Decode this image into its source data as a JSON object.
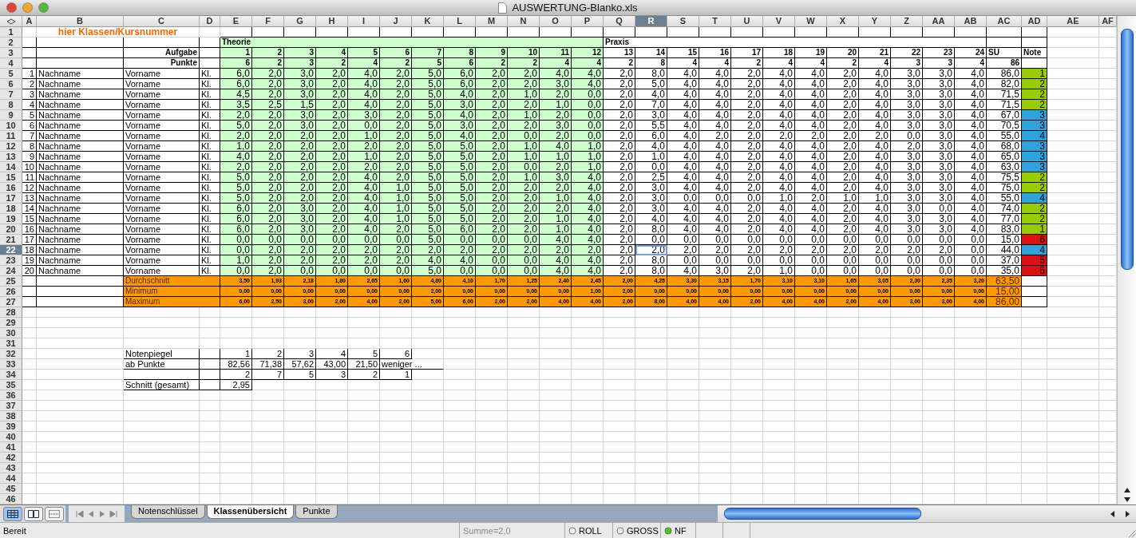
{
  "window": {
    "title": "AUSWERTUNG-Blanko.xls"
  },
  "column_headers": [
    {
      "label": "A",
      "selected": false
    },
    {
      "label": "B",
      "selected": false
    },
    {
      "label": "C",
      "selected": false
    },
    {
      "label": "D",
      "selected": false
    },
    {
      "label": "E",
      "selected": false
    },
    {
      "label": "F",
      "selected": false
    },
    {
      "label": "G",
      "selected": false
    },
    {
      "label": "H",
      "selected": false
    },
    {
      "label": "I",
      "selected": false
    },
    {
      "label": "J",
      "selected": false
    },
    {
      "label": "K",
      "selected": false
    },
    {
      "label": "L",
      "selected": false
    },
    {
      "label": "M",
      "selected": false
    },
    {
      "label": "N",
      "selected": false
    },
    {
      "label": "O",
      "selected": false
    },
    {
      "label": "P",
      "selected": false
    },
    {
      "label": "Q",
      "selected": false
    },
    {
      "label": "R",
      "selected": true
    },
    {
      "label": "S",
      "selected": false
    },
    {
      "label": "T",
      "selected": false
    },
    {
      "label": "U",
      "selected": false
    },
    {
      "label": "V",
      "selected": false
    },
    {
      "label": "W",
      "selected": false
    },
    {
      "label": "X",
      "selected": false
    },
    {
      "label": "Y",
      "selected": false
    },
    {
      "label": "Z",
      "selected": false
    },
    {
      "label": "AA",
      "selected": false
    },
    {
      "label": "AB",
      "selected": false
    },
    {
      "label": "AC",
      "selected": false
    },
    {
      "label": "AD",
      "selected": false
    },
    {
      "label": "AE",
      "selected": false
    },
    {
      "label": "AF",
      "selected": false
    }
  ],
  "row_headers": [
    {
      "label": "1",
      "selected": false
    },
    {
      "label": "2",
      "selected": false
    },
    {
      "label": "3",
      "selected": false
    },
    {
      "label": "4",
      "selected": false
    },
    {
      "label": "5",
      "selected": false
    },
    {
      "label": "6",
      "selected": false
    },
    {
      "label": "7",
      "selected": false
    },
    {
      "label": "8",
      "selected": false
    },
    {
      "label": "9",
      "selected": false
    },
    {
      "label": "10",
      "selected": false
    },
    {
      "label": "11",
      "selected": false
    },
    {
      "label": "12",
      "selected": false
    },
    {
      "label": "13",
      "selected": false
    },
    {
      "label": "14",
      "selected": false
    },
    {
      "label": "15",
      "selected": false
    },
    {
      "label": "16",
      "selected": false
    },
    {
      "label": "17",
      "selected": false
    },
    {
      "label": "18",
      "selected": false
    },
    {
      "label": "19",
      "selected": false
    },
    {
      "label": "20",
      "selected": false
    },
    {
      "label": "21",
      "selected": false
    },
    {
      "label": "22",
      "selected": true
    },
    {
      "label": "23",
      "selected": false
    },
    {
      "label": "24",
      "selected": false
    },
    {
      "label": "25",
      "selected": false
    },
    {
      "label": "26",
      "selected": false
    },
    {
      "label": "27",
      "selected": false
    },
    {
      "label": "28",
      "selected": false
    },
    {
      "label": "29",
      "selected": false
    },
    {
      "label": "30",
      "selected": false
    },
    {
      "label": "31",
      "selected": false
    },
    {
      "label": "32",
      "selected": false
    },
    {
      "label": "33",
      "selected": false
    },
    {
      "label": "34",
      "selected": false
    },
    {
      "label": "35",
      "selected": false
    },
    {
      "label": "36",
      "selected": false
    },
    {
      "label": "37",
      "selected": false
    },
    {
      "label": "38",
      "selected": false
    },
    {
      "label": "39",
      "selected": false
    },
    {
      "label": "40",
      "selected": false
    },
    {
      "label": "41",
      "selected": false
    },
    {
      "label": "42",
      "selected": false
    },
    {
      "label": "43",
      "selected": false
    },
    {
      "label": "44",
      "selected": false
    },
    {
      "label": "45",
      "selected": false
    },
    {
      "label": "46",
      "selected": false
    }
  ],
  "title_cell": "hier Klassen/Kursnummer",
  "sections": [
    {
      "label": "Theorie",
      "kind": "theory"
    },
    {
      "label": "Praxis",
      "kind": "practice"
    }
  ],
  "task_header": {
    "label": "Aufgabe",
    "numbers": [
      "1",
      "2",
      "3",
      "4",
      "5",
      "6",
      "7",
      "8",
      "9",
      "10",
      "11",
      "12",
      "13",
      "14",
      "15",
      "16",
      "17",
      "18",
      "19",
      "20",
      "21",
      "22",
      "23",
      "24"
    ],
    "sum_label": "SU",
    "grade_label": "Note"
  },
  "points_header": {
    "label": "Punkte",
    "max_points": [
      "6",
      "2",
      "3",
      "2",
      "4",
      "2",
      "5",
      "6",
      "2",
      "2",
      "4",
      "4",
      "2",
      "8",
      "4",
      "4",
      "2",
      "4",
      "4",
      "2",
      "4",
      "3",
      "3",
      "4"
    ],
    "total": "86"
  },
  "students": [
    {
      "no": "1",
      "last_name": "Nachname",
      "first_name": "Vorname",
      "class": "Kl.",
      "points": [
        "6,0",
        "2,0",
        "3,0",
        "2,0",
        "4,0",
        "2,0",
        "5,0",
        "6,0",
        "2,0",
        "2,0",
        "4,0",
        "4,0",
        "2,0",
        "8,0",
        "4,0",
        "4,0",
        "2,0",
        "4,0",
        "4,0",
        "2,0",
        "4,0",
        "3,0",
        "3,0",
        "4,0"
      ],
      "sum": "86,0",
      "grade": "1",
      "color": "#99cc00"
    },
    {
      "no": "2",
      "last_name": "Nachname",
      "first_name": "Vorname",
      "class": "Kl.",
      "points": [
        "6,0",
        "2,0",
        "3,0",
        "2,0",
        "4,0",
        "2,0",
        "5,0",
        "6,0",
        "2,0",
        "2,0",
        "3,0",
        "4,0",
        "2,0",
        "5,0",
        "4,0",
        "4,0",
        "2,0",
        "4,0",
        "4,0",
        "2,0",
        "4,0",
        "3,0",
        "3,0",
        "4,0"
      ],
      "sum": "82,0",
      "grade": "2",
      "color": "#99cc00"
    },
    {
      "no": "3",
      "last_name": "Nachname",
      "first_name": "Vorname",
      "class": "Kl.",
      "points": [
        "4,5",
        "2,0",
        "3,0",
        "2,0",
        "4,0",
        "2,0",
        "5,0",
        "4,0",
        "2,0",
        "1,0",
        "2,0",
        "0,0",
        "2,0",
        "4,0",
        "4,0",
        "4,0",
        "2,0",
        "4,0",
        "4,0",
        "2,0",
        "4,0",
        "3,0",
        "3,0",
        "4,0"
      ],
      "sum": "71,5",
      "grade": "2",
      "color": "#99cc00"
    },
    {
      "no": "4",
      "last_name": "Nachname",
      "first_name": "Vorname",
      "class": "Kl.",
      "points": [
        "3,5",
        "2,5",
        "1,5",
        "2,0",
        "4,0",
        "2,0",
        "5,0",
        "3,0",
        "2,0",
        "2,0",
        "1,0",
        "0,0",
        "2,0",
        "7,0",
        "4,0",
        "4,0",
        "2,0",
        "4,0",
        "4,0",
        "2,0",
        "4,0",
        "3,0",
        "3,0",
        "4,0"
      ],
      "sum": "71,5",
      "grade": "2",
      "color": "#99cc00"
    },
    {
      "no": "5",
      "last_name": "Nachname",
      "first_name": "Vorname",
      "class": "Kl.",
      "points": [
        "2,0",
        "2,0",
        "3,0",
        "2,0",
        "3,0",
        "2,0",
        "5,0",
        "4,0",
        "2,0",
        "1,0",
        "2,0",
        "0,0",
        "2,0",
        "3,0",
        "4,0",
        "4,0",
        "2,0",
        "4,0",
        "4,0",
        "2,0",
        "4,0",
        "3,0",
        "3,0",
        "4,0"
      ],
      "sum": "67,0",
      "grade": "3",
      "color": "#2fa4dc"
    },
    {
      "no": "6",
      "last_name": "Nachname",
      "first_name": "Vorname",
      "class": "Kl.",
      "points": [
        "5,0",
        "2,0",
        "3,0",
        "2,0",
        "0,0",
        "2,0",
        "5,0",
        "3,0",
        "2,0",
        "2,0",
        "3,0",
        "0,0",
        "2,0",
        "5,5",
        "4,0",
        "4,0",
        "2,0",
        "4,0",
        "4,0",
        "2,0",
        "4,0",
        "3,0",
        "3,0",
        "4,0"
      ],
      "sum": "70,5",
      "grade": "3",
      "color": "#2fa4dc"
    },
    {
      "no": "7",
      "last_name": "Nachname",
      "first_name": "Vorname",
      "class": "Kl.",
      "points": [
        "2,0",
        "2,0",
        "2,0",
        "2,0",
        "1,0",
        "2,0",
        "5,0",
        "4,0",
        "2,0",
        "0,0",
        "2,0",
        "0,0",
        "2,0",
        "6,0",
        "4,0",
        "2,0",
        "2,0",
        "2,0",
        "2,0",
        "2,0",
        "2,0",
        "0,0",
        "3,0",
        "4,0"
      ],
      "sum": "55,0",
      "grade": "4",
      "color": "#2fa4dc"
    },
    {
      "no": "8",
      "last_name": "Nachname",
      "first_name": "Vorname",
      "class": "Kl.",
      "points": [
        "1,0",
        "2,0",
        "2,0",
        "2,0",
        "2,0",
        "2,0",
        "5,0",
        "5,0",
        "2,0",
        "1,0",
        "4,0",
        "1,0",
        "2,0",
        "4,0",
        "4,0",
        "4,0",
        "2,0",
        "4,0",
        "4,0",
        "2,0",
        "4,0",
        "2,0",
        "3,0",
        "4,0"
      ],
      "sum": "68,0",
      "grade": "3",
      "color": "#2fa4dc"
    },
    {
      "no": "9",
      "last_name": "Nachname",
      "first_name": "Vorname",
      "class": "Kl.",
      "points": [
        "4,0",
        "2,0",
        "2,0",
        "2,0",
        "1,0",
        "2,0",
        "5,0",
        "5,0",
        "2,0",
        "1,0",
        "1,0",
        "1,0",
        "2,0",
        "1,0",
        "4,0",
        "4,0",
        "2,0",
        "4,0",
        "4,0",
        "2,0",
        "4,0",
        "3,0",
        "3,0",
        "4,0"
      ],
      "sum": "65,0",
      "grade": "3",
      "color": "#2fa4dc"
    },
    {
      "no": "10",
      "last_name": "Nachname",
      "first_name": "Vorname",
      "class": "Kl.",
      "points": [
        "2,0",
        "2,0",
        "2,0",
        "2,0",
        "2,0",
        "2,0",
        "5,0",
        "5,0",
        "2,0",
        "0,0",
        "2,0",
        "1,0",
        "2,0",
        "0,0",
        "4,0",
        "4,0",
        "2,0",
        "4,0",
        "4,0",
        "2,0",
        "4,0",
        "3,0",
        "3,0",
        "4,0"
      ],
      "sum": "63,0",
      "grade": "3",
      "color": "#2fa4dc"
    },
    {
      "no": "11",
      "last_name": "Nachname",
      "first_name": "Vorname",
      "class": "Kl.",
      "points": [
        "5,0",
        "2,0",
        "2,0",
        "2,0",
        "4,0",
        "2,0",
        "5,0",
        "5,0",
        "2,0",
        "1,0",
        "3,0",
        "4,0",
        "2,0",
        "2,5",
        "4,0",
        "4,0",
        "2,0",
        "4,0",
        "4,0",
        "2,0",
        "4,0",
        "3,0",
        "3,0",
        "4,0"
      ],
      "sum": "75,5",
      "grade": "2",
      "color": "#99cc00"
    },
    {
      "no": "12",
      "last_name": "Nachname",
      "first_name": "Vorname",
      "class": "Kl.",
      "points": [
        "5,0",
        "2,0",
        "2,0",
        "2,0",
        "4,0",
        "1,0",
        "5,0",
        "5,0",
        "2,0",
        "2,0",
        "2,0",
        "4,0",
        "2,0",
        "3,0",
        "4,0",
        "4,0",
        "2,0",
        "4,0",
        "4,0",
        "2,0",
        "4,0",
        "3,0",
        "3,0",
        "4,0"
      ],
      "sum": "75,0",
      "grade": "2",
      "color": "#99cc00"
    },
    {
      "no": "13",
      "last_name": "Nachname",
      "first_name": "Vorname",
      "class": "Kl.",
      "points": [
        "5,0",
        "2,0",
        "2,0",
        "2,0",
        "4,0",
        "1,0",
        "5,0",
        "5,0",
        "2,0",
        "2,0",
        "1,0",
        "4,0",
        "2,0",
        "3,0",
        "0,0",
        "0,0",
        "0,0",
        "1,0",
        "2,0",
        "1,0",
        "1,0",
        "3,0",
        "3,0",
        "4,0"
      ],
      "sum": "55,0",
      "grade": "4",
      "color": "#2fa4dc"
    },
    {
      "no": "14",
      "last_name": "Nachname",
      "first_name": "Vorname",
      "class": "Kl.",
      "points": [
        "6,0",
        "2,0",
        "3,0",
        "2,0",
        "4,0",
        "1,0",
        "5,0",
        "5,0",
        "2,0",
        "2,0",
        "2,0",
        "4,0",
        "2,0",
        "3,0",
        "4,0",
        "4,0",
        "2,0",
        "4,0",
        "4,0",
        "2,0",
        "4,0",
        "3,0",
        "0,0",
        "4,0"
      ],
      "sum": "74,0",
      "grade": "2",
      "color": "#99cc00"
    },
    {
      "no": "15",
      "last_name": "Nachname",
      "first_name": "Vorname",
      "class": "Kl.",
      "points": [
        "6,0",
        "2,0",
        "3,0",
        "2,0",
        "4,0",
        "1,0",
        "5,0",
        "5,0",
        "2,0",
        "2,0",
        "1,0",
        "4,0",
        "2,0",
        "4,0",
        "4,0",
        "4,0",
        "2,0",
        "4,0",
        "4,0",
        "2,0",
        "4,0",
        "3,0",
        "3,0",
        "4,0"
      ],
      "sum": "77,0",
      "grade": "2",
      "color": "#99cc00"
    },
    {
      "no": "16",
      "last_name": "Nachname",
      "first_name": "Vorname",
      "class": "Kl.",
      "points": [
        "6,0",
        "2,0",
        "3,0",
        "2,0",
        "4,0",
        "2,0",
        "5,0",
        "6,0",
        "2,0",
        "2,0",
        "1,0",
        "4,0",
        "2,0",
        "8,0",
        "4,0",
        "4,0",
        "2,0",
        "4,0",
        "4,0",
        "2,0",
        "4,0",
        "3,0",
        "3,0",
        "4,0"
      ],
      "sum": "83,0",
      "grade": "1",
      "color": "#99cc00"
    },
    {
      "no": "17",
      "last_name": "Nachname",
      "first_name": "Vorname",
      "class": "Kl.",
      "points": [
        "0,0",
        "0,0",
        "0,0",
        "0,0",
        "0,0",
        "0,0",
        "5,0",
        "0,0",
        "0,0",
        "0,0",
        "4,0",
        "4,0",
        "2,0",
        "0,0",
        "0,0",
        "0,0",
        "0,0",
        "0,0",
        "0,0",
        "0,0",
        "0,0",
        "0,0",
        "0,0",
        "0,0"
      ],
      "sum": "15,0",
      "grade": "6",
      "color": "#dd1111"
    },
    {
      "no": "18",
      "last_name": "Nachname",
      "first_name": "Vorname",
      "class": "Kl.",
      "points": [
        "0,0",
        "2,0",
        "2,0",
        "2,0",
        "2,0",
        "2,0",
        "2,0",
        "2,0",
        "2,0",
        "2,0",
        "2,0",
        "2,0",
        "2,0",
        "2,0",
        "2,0",
        "2,0",
        "2,0",
        "2,0",
        "2,0",
        "2,0",
        "2,0",
        "2,0",
        "2,0",
        "0,0"
      ],
      "sum": "44,0",
      "grade": "4",
      "color": "#2fa4dc"
    },
    {
      "no": "19",
      "last_name": "Nachname",
      "first_name": "Vorname",
      "class": "Kl.",
      "points": [
        "1,0",
        "2,0",
        "2,0",
        "2,0",
        "2,0",
        "2,0",
        "4,0",
        "4,0",
        "0,0",
        "0,0",
        "4,0",
        "4,0",
        "2,0",
        "8,0",
        "0,0",
        "0,0",
        "0,0",
        "0,0",
        "0,0",
        "0,0",
        "0,0",
        "0,0",
        "0,0",
        "0,0"
      ],
      "sum": "37,0",
      "grade": "5",
      "color": "#dd1111"
    },
    {
      "no": "20",
      "last_name": "Nachname",
      "first_name": "Vorname",
      "class": "Kl.",
      "points": [
        "0,0",
        "2,0",
        "0,0",
        "0,0",
        "0,0",
        "0,0",
        "5,0",
        "0,0",
        "0,0",
        "0,0",
        "4,0",
        "4,0",
        "2,0",
        "8,0",
        "4,0",
        "3,0",
        "2,0",
        "1,0",
        "0,0",
        "0,0",
        "0,0",
        "0,0",
        "0,0",
        "0,0"
      ],
      "sum": "35,0",
      "grade": "5",
      "color": "#dd1111"
    }
  ],
  "stats": [
    {
      "label": "Durchschnitt",
      "values": [
        "3,50",
        "1,93",
        "2,18",
        "1,80",
        "2,65",
        "1,60",
        "4,80",
        "4,10",
        "1,70",
        "1,25",
        "2,40",
        "2,45",
        "2,00",
        "4,25",
        "3,30",
        "3,15",
        "1,70",
        "3,10",
        "3,10",
        "1,65",
        "3,05",
        "2,30",
        "2,35",
        "3,20"
      ],
      "sum": "63,50"
    },
    {
      "label": "Minimum",
      "values": [
        "0,00",
        "0,00",
        "0,00",
        "0,00",
        "0,00",
        "0,00",
        "2,00",
        "0,00",
        "0,00",
        "0,00",
        "0,00",
        "1,00",
        "2,00",
        "0,00",
        "0,00",
        "0,00",
        "0,00",
        "0,00",
        "0,00",
        "0,00",
        "0,00",
        "0,00",
        "0,00",
        "0,00"
      ],
      "sum": "15,00"
    },
    {
      "label": "Maximum",
      "values": [
        "6,00",
        "2,50",
        "3,00",
        "2,00",
        "4,00",
        "2,00",
        "5,00",
        "6,00",
        "2,00",
        "2,00",
        "4,00",
        "4,00",
        "2,00",
        "8,00",
        "4,00",
        "4,00",
        "2,00",
        "4,00",
        "4,00",
        "2,00",
        "4,00",
        "3,00",
        "3,00",
        "4,00"
      ],
      "sum": "86,00"
    }
  ],
  "grade_table": {
    "rows": [
      {
        "label": "Notenpiegel",
        "values": [
          "1",
          "2",
          "3",
          "4",
          "5",
          "6"
        ]
      },
      {
        "label": "ab Punkte",
        "values": [
          "82,56",
          "71,38",
          "57,62",
          "43,00",
          "21,50",
          "weniger ..."
        ]
      },
      {
        "values": [
          "2",
          "7",
          "5",
          "3",
          "2",
          "1"
        ]
      }
    ],
    "average": {
      "label": "Schnitt (gesamt)",
      "value": "2,95"
    }
  },
  "sheet_tabs": [
    {
      "label": "Notenschlüssel",
      "selected": false
    },
    {
      "label": "Klassenübersicht",
      "selected": true
    },
    {
      "label": "Punkte",
      "selected": false
    }
  ],
  "status_bar": {
    "mode": "Bereit",
    "sum": "Summe=2,0",
    "indicators": [
      {
        "label": "ROLL",
        "on": false
      },
      {
        "label": "GROSS",
        "on": false
      },
      {
        "label": "NF",
        "on": true
      }
    ]
  }
}
